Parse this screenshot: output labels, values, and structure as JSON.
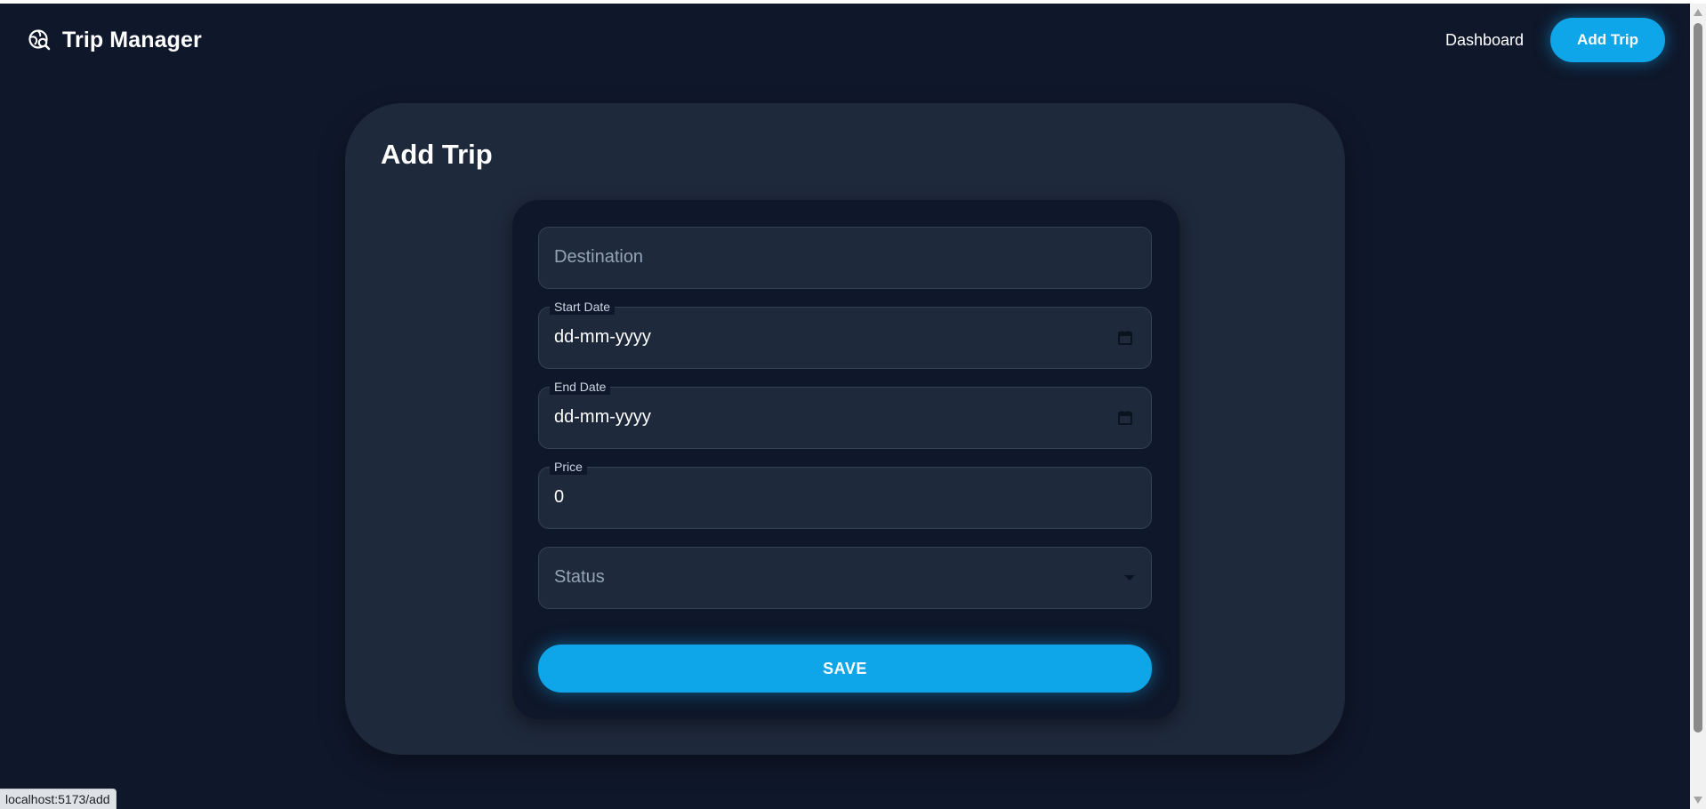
{
  "header": {
    "brand_title": "Trip Manager",
    "nav": {
      "dashboard_label": "Dashboard",
      "add_trip_label": "Add Trip"
    }
  },
  "page": {
    "title": "Add Trip"
  },
  "form": {
    "destination": {
      "placeholder": "Destination",
      "value": ""
    },
    "start_date": {
      "label": "Start Date",
      "value": "dd-mm-yyyy"
    },
    "end_date": {
      "label": "End Date",
      "value": "dd-mm-yyyy"
    },
    "price": {
      "label": "Price",
      "value": "0"
    },
    "status": {
      "placeholder": "Status",
      "value": ""
    },
    "save_label": "SAVE"
  },
  "browser": {
    "status_url": "localhost:5173/add"
  },
  "colors": {
    "background": "#0f172a",
    "card": "#1e293b",
    "accent": "#0ea5e9"
  },
  "icons": {
    "brand": "globe-search-icon",
    "date": "calendar-icon",
    "select": "caret-down-icon"
  }
}
